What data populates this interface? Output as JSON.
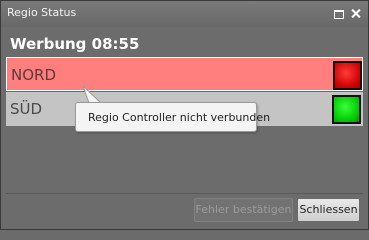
{
  "window": {
    "title": "Regio Status",
    "maximize_icon": "maximize-icon",
    "close_icon": "close-icon"
  },
  "heading": "Werbung 08:55",
  "regions": [
    {
      "name": "NORD",
      "status": "error",
      "indicator_color": "#e00000",
      "row_color": "#ff7f7f"
    },
    {
      "name": "SÜD",
      "status": "ok",
      "indicator_color": "#00d000",
      "row_color": "#c4c4c4"
    }
  ],
  "tooltip": {
    "text": "Regio Controller nicht verbunden"
  },
  "buttons": {
    "confirm_errors": "Fehler bestätigen",
    "close": "Schliessen"
  }
}
